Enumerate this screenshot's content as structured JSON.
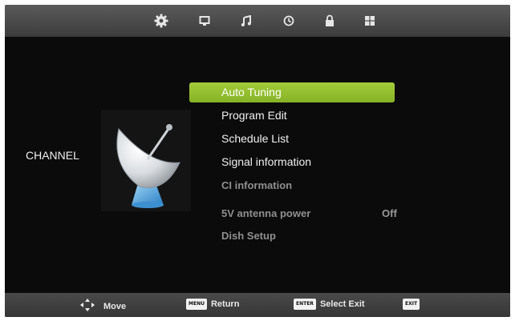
{
  "top_tabs": [
    {
      "icon": "gear-icon",
      "active": true
    },
    {
      "icon": "monitor-icon",
      "active": false
    },
    {
      "icon": "music-note-icon",
      "active": false
    },
    {
      "icon": "clock-icon",
      "active": false
    },
    {
      "icon": "lock-icon",
      "active": false
    },
    {
      "icon": "grid-icon",
      "active": false
    }
  ],
  "category": {
    "label": "CHANNEL",
    "image": "satellite-dish-icon"
  },
  "menu": {
    "items": [
      {
        "label": "Auto Tuning",
        "state": "selected"
      },
      {
        "label": "Program Edit",
        "state": "enabled"
      },
      {
        "label": "Schedule List",
        "state": "enabled"
      },
      {
        "label": "Signal information",
        "state": "enabled"
      },
      {
        "label": "CI information",
        "state": "disabled"
      },
      {
        "label": "5V antenna power",
        "state": "disabled",
        "value": "Off"
      },
      {
        "label": "Dish Setup",
        "state": "disabled"
      }
    ]
  },
  "help_bar": {
    "move_label": "Move",
    "menu_key": "MENU",
    "return_label": "Return",
    "enter_key": "ENTER",
    "select_exit_label": "Select Exit",
    "exit_key": "EXIT"
  },
  "colors": {
    "highlight": "#96c02e",
    "background": "#0b0b0b",
    "bar": "#4a4a4a"
  }
}
